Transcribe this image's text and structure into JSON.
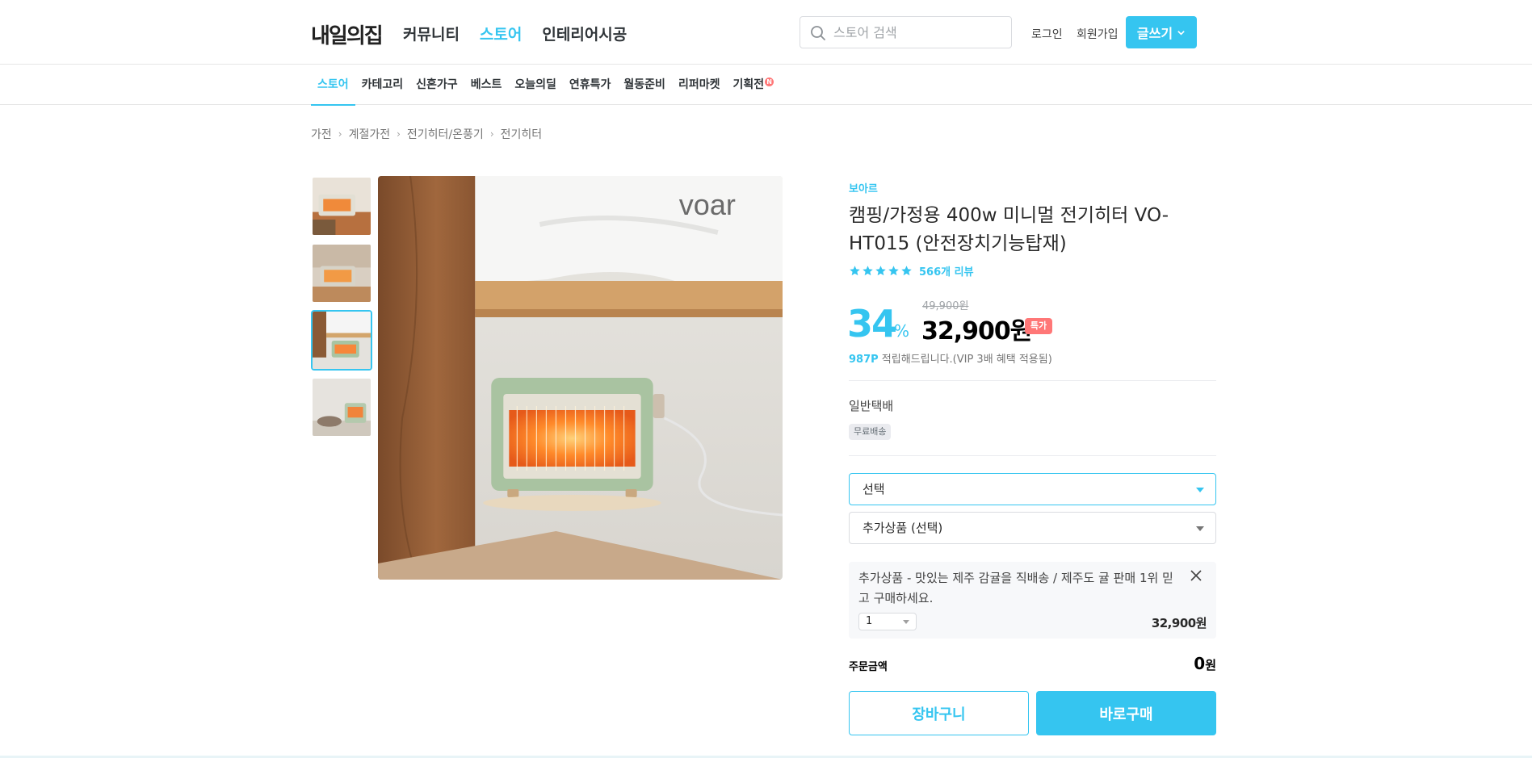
{
  "header": {
    "logo": "내일의집",
    "nav": [
      "커뮤니티",
      "스토어",
      "인테리어시공"
    ],
    "active_nav": "스토어",
    "search_placeholder": "스토어 검색",
    "login": "로그인",
    "signup": "회원가입",
    "write_button": "글쓰기"
  },
  "subnav": {
    "items": [
      "스토어",
      "카테고리",
      "신혼가구",
      "베스트",
      "오늘의딜",
      "연휴특가",
      "월동준비",
      "리퍼마켓",
      "기획전"
    ],
    "new_badge": "N"
  },
  "breadcrumb": [
    "가전",
    "계절가전",
    "전기히터/온풍기",
    "전기히터"
  ],
  "gallery": {
    "thumbnail_count": 4,
    "selected_thumbnail": 3,
    "main_image_watermark": "voar"
  },
  "product": {
    "brand": "보아르",
    "title": "캠핑/가정용 400w 미니멀 전기히터 VO-HT015 (안전장치기능탑재)",
    "rating": 5,
    "reviews": "566개 리뷰",
    "original_price": "49,900원",
    "discount": "34",
    "discount_unit": "%",
    "price": "32,900원",
    "badge": "특가",
    "points": "987P",
    "points_text": " 적립해드립니다.(VIP 3배 혜택 적용됨)"
  },
  "shipping": {
    "title": "일반택배",
    "tag": "무료배송"
  },
  "options": {
    "select1": "선택",
    "select2": "추가상품 (선택)"
  },
  "added_item": {
    "text": "추가상품 - 맛있는 제주 감귤을 직배송 / 제주도 귤 판매 1위 믿고 구매하세요.",
    "quantity": "1",
    "price": "32,900원"
  },
  "order": {
    "label": "주문금액",
    "amount": "0",
    "unit": "원"
  },
  "buttons": {
    "cart": "장바구니",
    "buy": "바로구매"
  },
  "colors": {
    "accent": "#35c5f0",
    "badge": "#ff7777"
  }
}
